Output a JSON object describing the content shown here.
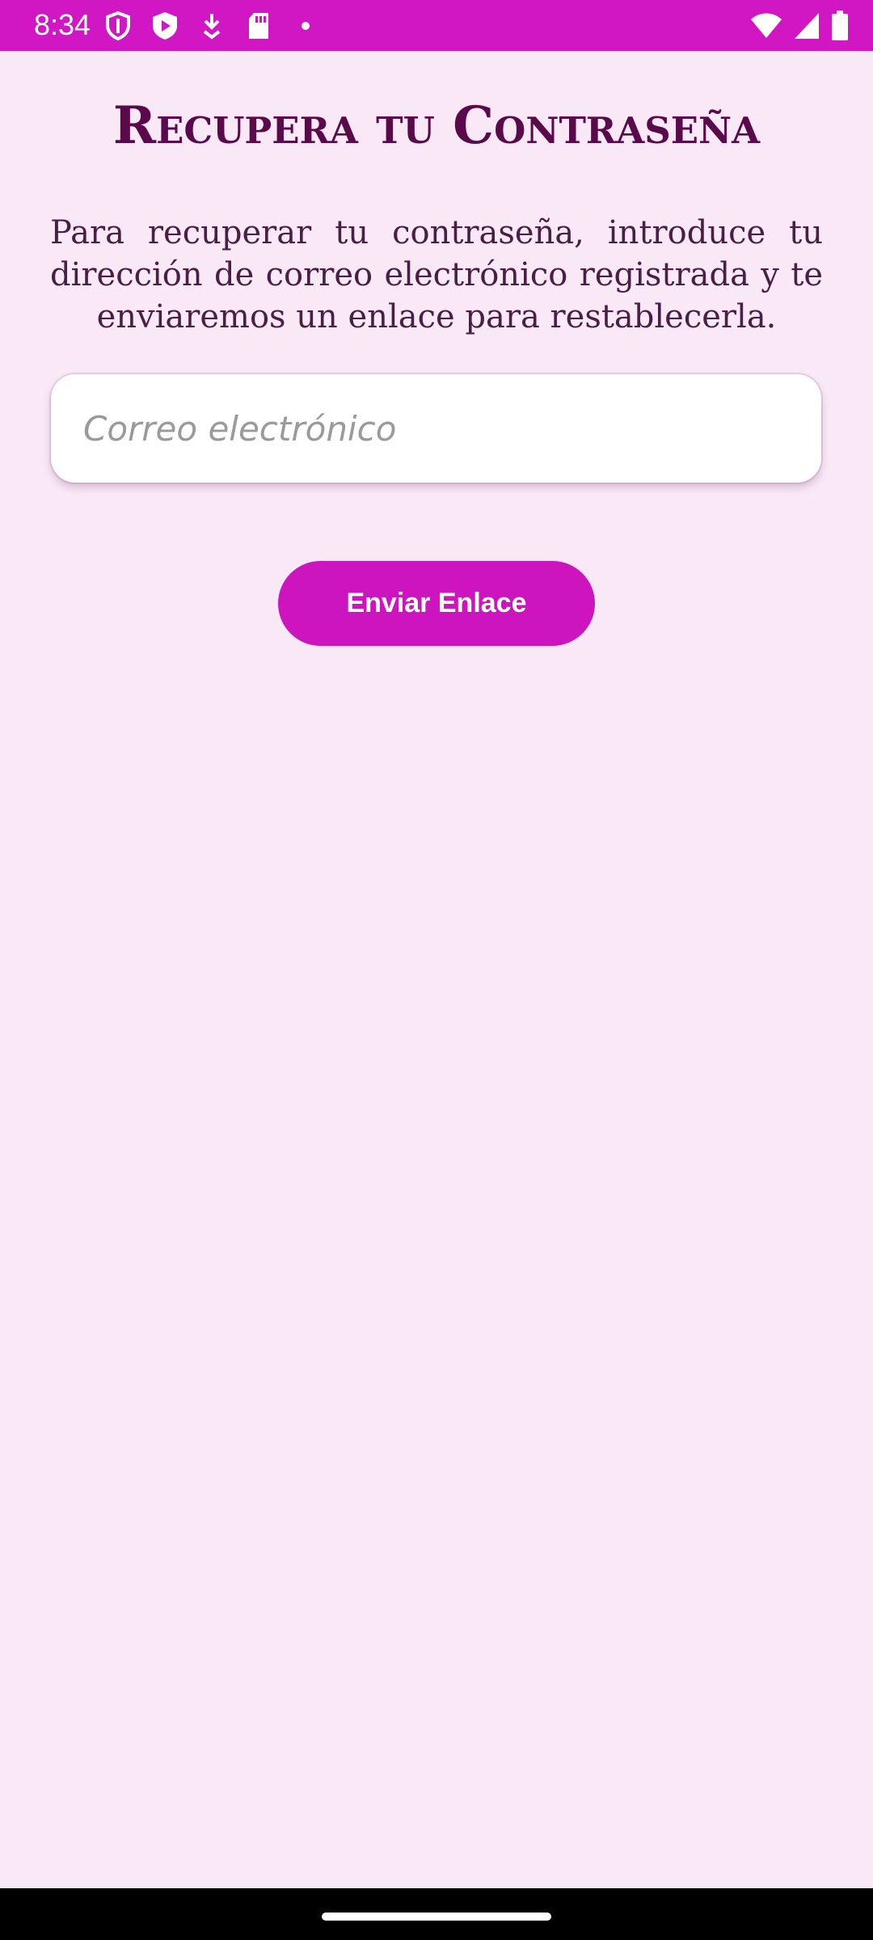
{
  "status_bar": {
    "time": "8:34",
    "color": "#d116c4",
    "icons_left": [
      "shield-icon",
      "play-protect-icon",
      "download-icon",
      "sd-card-icon",
      "dot-icon"
    ],
    "icons_right": [
      "wifi-icon",
      "signal-icon",
      "battery-icon"
    ]
  },
  "page": {
    "title": "Recupera tu Contraseña",
    "description": "Para recuperar tu contraseña, introduce tu dirección de correo electrónico registrada y te enviaremos un enlace para restablecerla.",
    "background": "#f9e8f6"
  },
  "form": {
    "email_placeholder": "Correo electrónico",
    "email_value": "",
    "send_label": "Enviar Enlace",
    "button_color": "#cc14bf"
  }
}
